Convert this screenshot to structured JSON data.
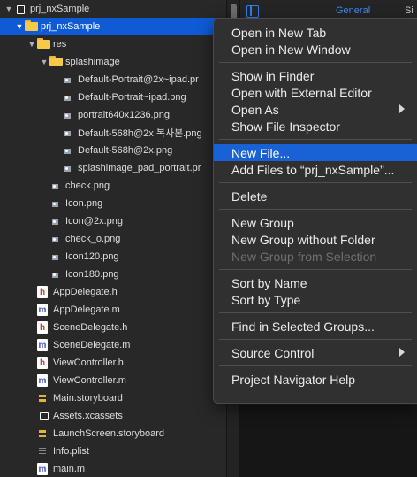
{
  "navigator": {
    "rows": [
      {
        "label": "prj_nxSample",
        "icon": "project-icon",
        "expanded": true
      },
      {
        "label": "prj_nxSample",
        "icon": "folder-icon",
        "expanded": true,
        "selected": true
      },
      {
        "label": "res",
        "icon": "folder-icon",
        "expanded": true
      },
      {
        "label": "splashimage",
        "icon": "folder-icon",
        "expanded": true
      },
      {
        "label": "Default-Portrait@2x~ipad.pr",
        "icon": "image-file-icon"
      },
      {
        "label": "Default-Portrait~ipad.png",
        "icon": "image-file-icon"
      },
      {
        "label": "portrait640x1236.png",
        "icon": "image-file-icon"
      },
      {
        "label": "Default-568h@2x 복사본.png",
        "icon": "image-file-icon"
      },
      {
        "label": "Default-568h@2x.png",
        "icon": "image-file-icon"
      },
      {
        "label": "splashimage_pad_portrait.pr",
        "icon": "image-file-icon"
      },
      {
        "label": "check.png",
        "icon": "image-file-icon"
      },
      {
        "label": "Icon.png",
        "icon": "image-file-icon"
      },
      {
        "label": "Icon@2x.png",
        "icon": "image-file-icon"
      },
      {
        "label": "check_o.png",
        "icon": "image-file-icon"
      },
      {
        "label": "Icon120.png",
        "icon": "image-file-icon"
      },
      {
        "label": "Icon180.png",
        "icon": "image-file-icon"
      },
      {
        "label": "AppDelegate.h",
        "icon": "header-file-icon"
      },
      {
        "label": "AppDelegate.m",
        "icon": "objc-file-icon"
      },
      {
        "label": "SceneDelegate.h",
        "icon": "header-file-icon"
      },
      {
        "label": "SceneDelegate.m",
        "icon": "objc-file-icon"
      },
      {
        "label": "ViewController.h",
        "icon": "header-file-icon"
      },
      {
        "label": "ViewController.m",
        "icon": "objc-file-icon"
      },
      {
        "label": "Main.storyboard",
        "icon": "storyboard-icon"
      },
      {
        "label": "Assets.xcassets",
        "icon": "assets-icon"
      },
      {
        "label": "LaunchScreen.storyboard",
        "icon": "storyboard-icon"
      },
      {
        "label": "Info.plist",
        "icon": "plist-icon"
      },
      {
        "label": "main.m",
        "icon": "objc-file-icon"
      }
    ]
  },
  "editor": {
    "tab_general": "General",
    "tab_signing": "Si"
  },
  "context_menu": {
    "groups": [
      [
        {
          "label": "Open in New Tab"
        },
        {
          "label": "Open in New Window"
        }
      ],
      [
        {
          "label": "Show in Finder"
        },
        {
          "label": "Open with External Editor"
        },
        {
          "label": "Open As",
          "submenu": true
        },
        {
          "label": "Show File Inspector"
        }
      ],
      [
        {
          "label": "New File...",
          "highlighted": true
        },
        {
          "label": "Add Files to “prj_nxSample”..."
        }
      ],
      [
        {
          "label": "Delete"
        }
      ],
      [
        {
          "label": "New Group"
        },
        {
          "label": "New Group without Folder"
        },
        {
          "label": "New Group from Selection",
          "disabled": true
        }
      ],
      [
        {
          "label": "Sort by Name"
        },
        {
          "label": "Sort by Type"
        }
      ],
      [
        {
          "label": "Find in Selected Groups..."
        }
      ],
      [
        {
          "label": "Source Control",
          "submenu": true
        }
      ],
      [
        {
          "label": "Project Navigator Help"
        }
      ]
    ]
  },
  "colors": {
    "selection": "#0f5bd6",
    "menu_highlight": "#1962d5",
    "accent": "#3b8cf5"
  }
}
